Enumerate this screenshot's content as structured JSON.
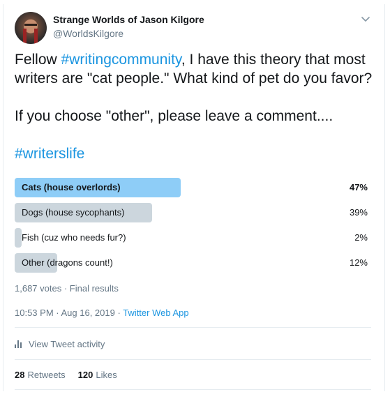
{
  "author": {
    "display_name": "Strange Worlds of Jason Kilgore",
    "handle": "@WorldsKilgore",
    "menu_icon": "chevron-down-icon"
  },
  "tweet": {
    "line1_prefix": "Fellow ",
    "hashtag1": "#writingcommunity",
    "line1_suffix": ", I have this theory that most writers are \"cat people.\" What kind of pet do you favor?",
    "line2": "If you choose \"other\", please leave a comment....",
    "hashtag2": "#writerslife"
  },
  "poll": {
    "options": [
      {
        "label": "Cats (house overlords)",
        "percent_text": "47%",
        "percent": 47,
        "winner": true
      },
      {
        "label": "Dogs (house sycophants)",
        "percent_text": "39%",
        "percent": 39,
        "winner": false
      },
      {
        "label": "Fish (cuz who needs fur?)",
        "percent_text": "2%",
        "percent": 2,
        "winner": false
      },
      {
        "label": "Other (dragons count!)",
        "percent_text": "12%",
        "percent": 12,
        "winner": false
      }
    ],
    "votes_text": "1,687 votes",
    "separator": " · ",
    "status_text": "Final results",
    "winner_color": "#8ecdf7",
    "other_color": "#ccd6dd"
  },
  "meta": {
    "time": "10:53 PM",
    "date": "Aug 16, 2019",
    "separator": " · ",
    "source": "Twitter Web App"
  },
  "activity": {
    "icon": "bar-chart-icon",
    "label": "View Tweet activity"
  },
  "engagement": {
    "retweets_count": "28",
    "retweets_label": "Retweets",
    "likes_count": "120",
    "likes_label": "Likes"
  }
}
